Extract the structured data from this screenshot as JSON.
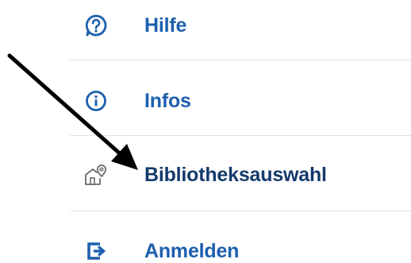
{
  "colors": {
    "accent": "#1d5fae",
    "bibliothek_label": "#143a6b",
    "bibliothek_icon": "#6b6b6b",
    "divider": "#e3e3e3",
    "arrow": "#000000"
  },
  "menu": {
    "items": [
      {
        "label": "Hilfe",
        "icon": "help-bubble-icon"
      },
      {
        "label": "Infos",
        "icon": "info-icon"
      },
      {
        "label": "Bibliotheksauswahl",
        "icon": "library-location-icon"
      },
      {
        "label": "Anmelden",
        "icon": "login-icon"
      }
    ]
  },
  "annotation": {
    "icon": "pointer-arrow-icon"
  }
}
